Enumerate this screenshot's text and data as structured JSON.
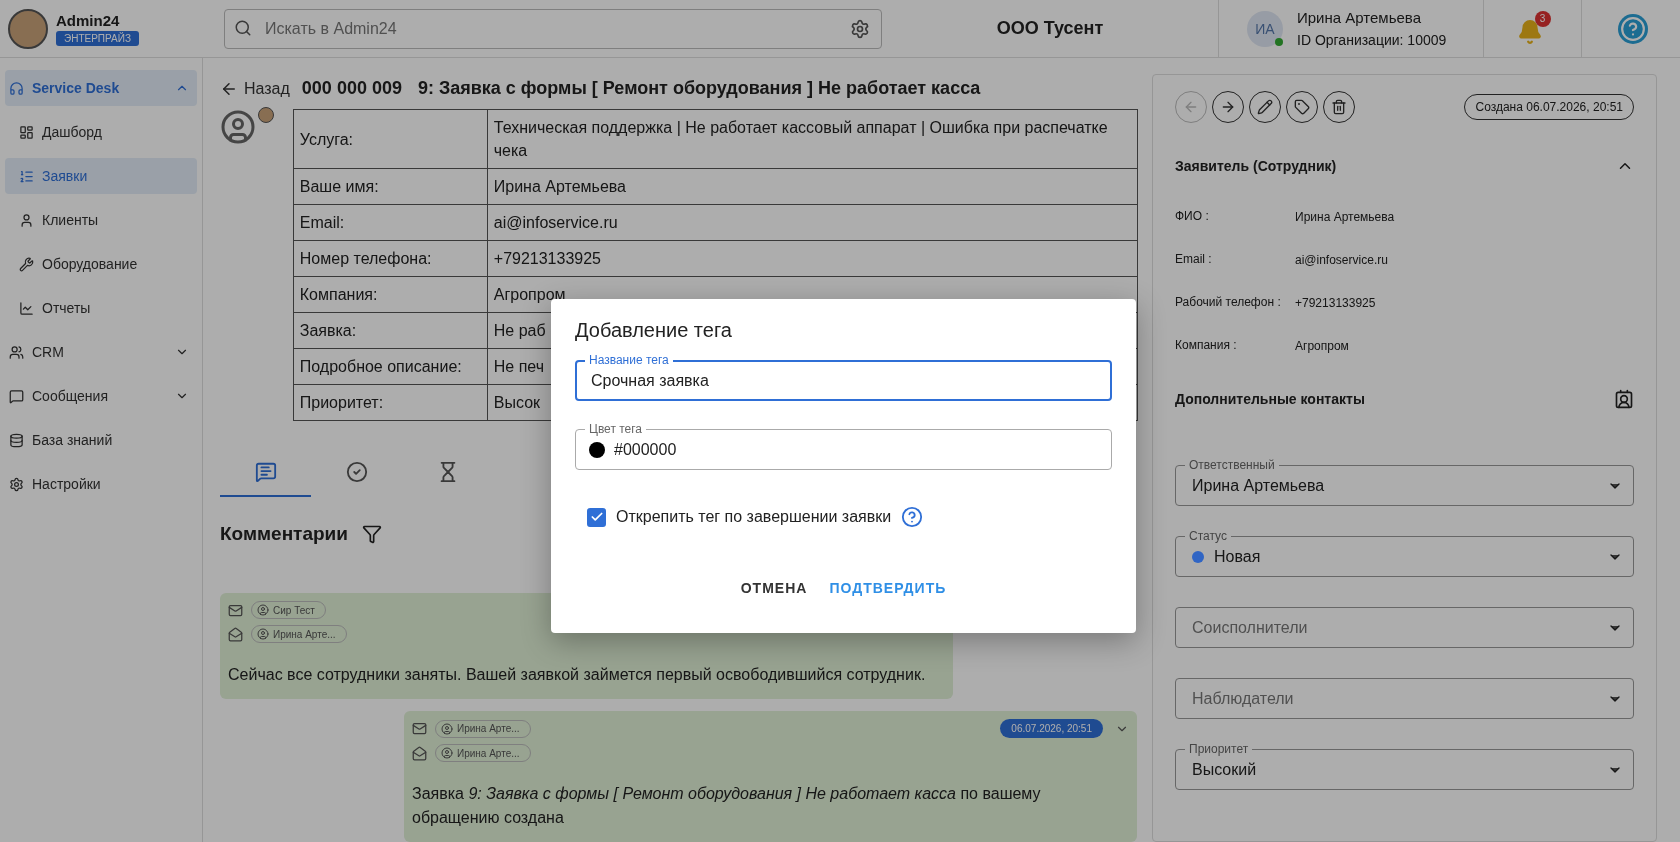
{
  "header": {
    "app_name": "Admin24",
    "plan_badge": "ЭНТЕРПРАЙЗ",
    "search": {
      "placeholder": "Искать в Admin24"
    },
    "organization": "ООО Тусент",
    "user": {
      "initials": "ИА",
      "online": true,
      "name": "Ирина Артемьева",
      "org_id": "ID Организации: 10009"
    },
    "notifications_count": "3"
  },
  "sidebar": {
    "items": [
      {
        "kind": "section",
        "label": "Service Desk",
        "expanded": true,
        "children": [
          {
            "label": "Дашборд",
            "selected": false
          },
          {
            "label": "Заявки",
            "selected": true
          },
          {
            "label": "Клиенты",
            "selected": false
          },
          {
            "label": "Оборудование",
            "selected": false
          },
          {
            "label": "Отчеты",
            "selected": false
          }
        ]
      },
      {
        "kind": "section",
        "label": "CRM",
        "expanded": false
      },
      {
        "kind": "section",
        "label": "Сообщения",
        "expanded": false
      },
      {
        "kind": "link",
        "label": "База знаний"
      },
      {
        "kind": "link",
        "label": "Настройки"
      }
    ]
  },
  "ticket": {
    "back": "Назад",
    "number": "000 000 009",
    "title": "9: Заявка с формы [ Ремонт оборудования ] Не работает касса",
    "fields": [
      {
        "label": "Услуга:",
        "value": "Техническая поддержка | Не работает кассовый аппарат | Ошибка при распечатке чека"
      },
      {
        "label": "Ваше имя:",
        "value": "Ирина Артемьева"
      },
      {
        "label": "Email:",
        "value": "ai@infoservice.ru"
      },
      {
        "label": "Номер телефона:",
        "value": "+79213133925"
      },
      {
        "label": "Компания:",
        "value": "Агропром"
      },
      {
        "label": "Заявка:",
        "value": "Не раб"
      },
      {
        "label": "Подробное описание:",
        "value": "Не печ"
      },
      {
        "label": "Приоритет:",
        "value": "Высок"
      }
    ],
    "tabs": [
      {
        "kind": "comments",
        "selected": true
      },
      {
        "kind": "tasks",
        "selected": false
      },
      {
        "kind": "time",
        "selected": false
      }
    ]
  },
  "comments": {
    "title": "Комментарии",
    "messages": [
      {
        "recipients": [
          {
            "name": "Сир Тест"
          },
          {
            "name": "Ирина Арте..."
          }
        ],
        "text": "Сейчас все сотрудники заняты. Вашей заявкой займется первый освободившийся сотрудник."
      },
      {
        "recipients": [
          {
            "name": "Ирина Арте..."
          },
          {
            "name": "Ирина Арте..."
          }
        ],
        "date": "06.07.2026, 20:51",
        "text": "Заявка *9: Заявка с формы [ Ремонт оборудования ] Не работает касса* по вашему обращению создана"
      }
    ]
  },
  "details": {
    "actions": [
      {
        "kind": "back",
        "disabled": true
      },
      {
        "kind": "forward",
        "disabled": false
      },
      {
        "kind": "edit",
        "disabled": false
      },
      {
        "kind": "tag",
        "disabled": false
      },
      {
        "kind": "delete",
        "disabled": false
      }
    ],
    "created": "Создана 06.07.2026, 20:51",
    "applicant": {
      "title": "Заявитель (Сотрудник)",
      "expanded": true,
      "rows": [
        {
          "label": "ФИО :",
          "value": "Ирина Артемьева"
        },
        {
          "label": "Email :",
          "value": "ai@infoservice.ru"
        },
        {
          "label": "Рабочий телефон :",
          "value": "+79213133925"
        },
        {
          "label": "Компания :",
          "value": "Агропром"
        }
      ]
    },
    "contacts_title": "Дополнительные контакты",
    "selects": [
      {
        "label": "Ответственный",
        "value": "Ирина Артемьева"
      },
      {
        "label": "Статус",
        "value": "Новая",
        "color": "#3065c4"
      },
      {
        "placeholder": "Соисполнители"
      },
      {
        "placeholder": "Наблюдатели"
      },
      {
        "label": "Приоритет",
        "value": "Высокий"
      }
    ]
  },
  "dialog": {
    "title": "Добавление тега",
    "name_field": {
      "label": "Название тега",
      "value": "Срочная заявка",
      "focused": true
    },
    "color_field": {
      "label": "Цвет тега",
      "value": "#000000",
      "color": "#000000"
    },
    "checkbox": {
      "label": "Открепить тег по завершении заявки",
      "checked": true
    },
    "buttons": [
      {
        "label": "ОТМЕНА",
        "kind": "secondary"
      },
      {
        "label": "ПОДТВЕРДИТЬ",
        "kind": "primary"
      }
    ]
  }
}
